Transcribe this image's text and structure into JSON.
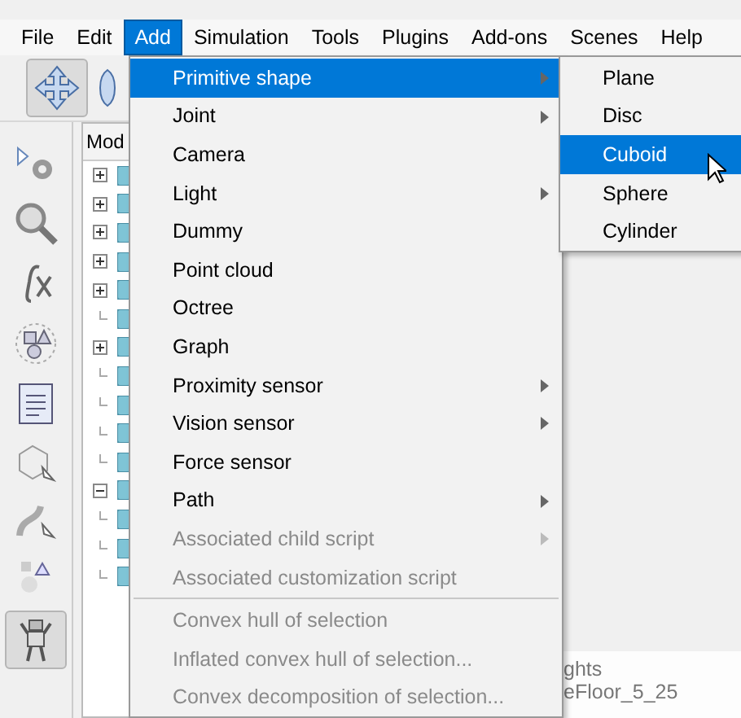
{
  "menubar": [
    {
      "label": "File",
      "selected": false
    },
    {
      "label": "Edit",
      "selected": false
    },
    {
      "label": "Add",
      "selected": true
    },
    {
      "label": "Simulation",
      "selected": false
    },
    {
      "label": "Tools",
      "selected": false
    },
    {
      "label": "Plugins",
      "selected": false
    },
    {
      "label": "Add-ons",
      "selected": false
    },
    {
      "label": "Scenes",
      "selected": false
    },
    {
      "label": "Help",
      "selected": false
    }
  ],
  "tree": {
    "header": "Mod",
    "rows": [
      {
        "kind": "plus"
      },
      {
        "kind": "plus"
      },
      {
        "kind": "plus"
      },
      {
        "kind": "plus"
      },
      {
        "kind": "plus"
      },
      {
        "kind": "line"
      },
      {
        "kind": "plus"
      },
      {
        "kind": "line"
      },
      {
        "kind": "line"
      },
      {
        "kind": "line"
      },
      {
        "kind": "line"
      },
      {
        "kind": "minus"
      },
      {
        "kind": "line"
      },
      {
        "kind": "line"
      },
      {
        "kind": "line"
      }
    ]
  },
  "scene": {
    "lines": [
      "ghts",
      "eFloor_5_25"
    ]
  },
  "add_menu": [
    {
      "kind": "item",
      "label": "Primitive shape",
      "has_submenu": true,
      "disabled": false,
      "selected": true
    },
    {
      "kind": "item",
      "label": "Joint",
      "has_submenu": true,
      "disabled": false,
      "selected": false
    },
    {
      "kind": "item",
      "label": "Camera",
      "has_submenu": false,
      "disabled": false,
      "selected": false
    },
    {
      "kind": "item",
      "label": "Light",
      "has_submenu": true,
      "disabled": false,
      "selected": false
    },
    {
      "kind": "item",
      "label": "Dummy",
      "has_submenu": false,
      "disabled": false,
      "selected": false
    },
    {
      "kind": "item",
      "label": "Point cloud",
      "has_submenu": false,
      "disabled": false,
      "selected": false
    },
    {
      "kind": "item",
      "label": "Octree",
      "has_submenu": false,
      "disabled": false,
      "selected": false
    },
    {
      "kind": "item",
      "label": "Graph",
      "has_submenu": false,
      "disabled": false,
      "selected": false
    },
    {
      "kind": "item",
      "label": "Proximity sensor",
      "has_submenu": true,
      "disabled": false,
      "selected": false
    },
    {
      "kind": "item",
      "label": "Vision sensor",
      "has_submenu": true,
      "disabled": false,
      "selected": false
    },
    {
      "kind": "item",
      "label": "Force sensor",
      "has_submenu": false,
      "disabled": false,
      "selected": false
    },
    {
      "kind": "item",
      "label": "Path",
      "has_submenu": true,
      "disabled": false,
      "selected": false
    },
    {
      "kind": "item",
      "label": "Associated child script",
      "has_submenu": true,
      "disabled": true,
      "selected": false
    },
    {
      "kind": "item",
      "label": "Associated customization script",
      "has_submenu": false,
      "disabled": true,
      "selected": false
    },
    {
      "kind": "separator"
    },
    {
      "kind": "item",
      "label": "Convex hull of selection",
      "has_submenu": false,
      "disabled": true,
      "selected": false
    },
    {
      "kind": "item",
      "label": "Inflated convex hull of selection...",
      "has_submenu": false,
      "disabled": true,
      "selected": false
    },
    {
      "kind": "item",
      "label": "Convex decomposition of selection...",
      "has_submenu": false,
      "disabled": true,
      "selected": false
    }
  ],
  "submenu": [
    {
      "label": "Plane",
      "selected": false
    },
    {
      "label": "Disc",
      "selected": false
    },
    {
      "label": "Cuboid",
      "selected": true
    },
    {
      "label": "Sphere",
      "selected": false
    },
    {
      "label": "Cylinder",
      "selected": false
    }
  ]
}
